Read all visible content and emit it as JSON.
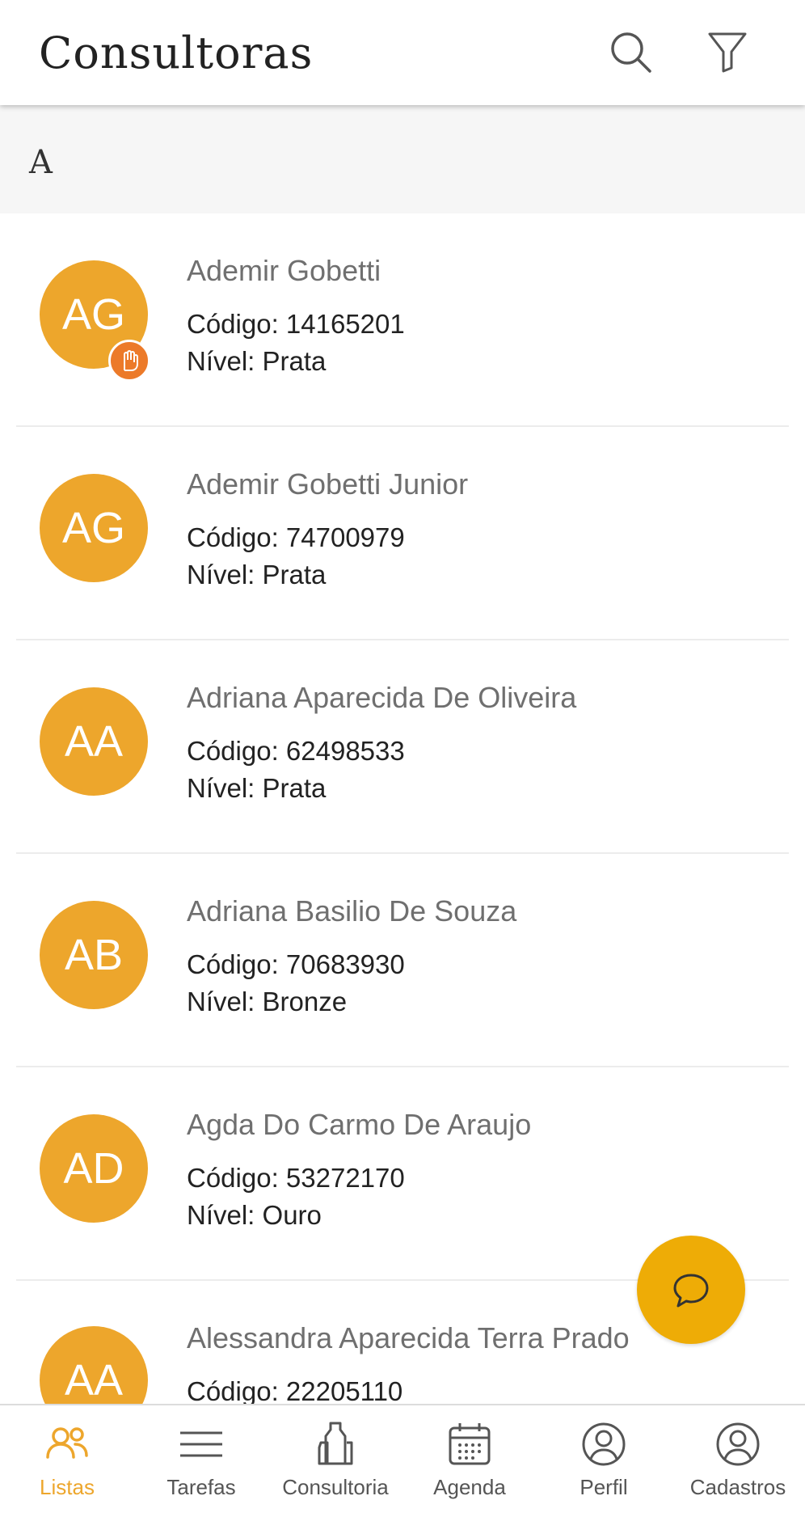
{
  "header": {
    "title": "Consultoras",
    "icons": [
      "search-icon",
      "filter-icon"
    ]
  },
  "section": {
    "letter": "A"
  },
  "consultants": [
    {
      "initials": "AG",
      "name": "Ademir Gobetti",
      "code": "Código: 14165201",
      "level": "Nível: Prata",
      "badge": "hand-icon"
    },
    {
      "initials": "AG",
      "name": "Ademir Gobetti Junior",
      "code": "Código: 74700979",
      "level": "Nível: Prata"
    },
    {
      "initials": "AA",
      "name": "Adriana Aparecida De Oliveira",
      "code": "Código: 62498533",
      "level": "Nível: Prata"
    },
    {
      "initials": "AB",
      "name": "Adriana Basilio De Souza",
      "code": "Código: 70683930",
      "level": "Nível: Bronze"
    },
    {
      "initials": "AD",
      "name": "Agda Do Carmo De Araujo",
      "code": "Código: 53272170",
      "level": "Nível: Ouro"
    },
    {
      "initials": "AA",
      "name": "Alessandra Aparecida Terra Prado",
      "code": "Código: 22205110",
      "level": ""
    }
  ],
  "fab": {
    "icon": "chat-icon"
  },
  "nav": {
    "items": [
      {
        "label": "Listas",
        "icon": "people-icon",
        "active": true
      },
      {
        "label": "Tarefas",
        "icon": "list-icon"
      },
      {
        "label": "Consultoria",
        "icon": "bottles-icon"
      },
      {
        "label": "Agenda",
        "icon": "calendar-icon"
      },
      {
        "label": "Perfil",
        "icon": "user-circle-icon"
      },
      {
        "label": "Cadastros",
        "icon": "user-circle-icon"
      }
    ]
  },
  "colors": {
    "accent": "#eda62c",
    "fab": "#eeac06",
    "badge": "#ec7a29"
  }
}
